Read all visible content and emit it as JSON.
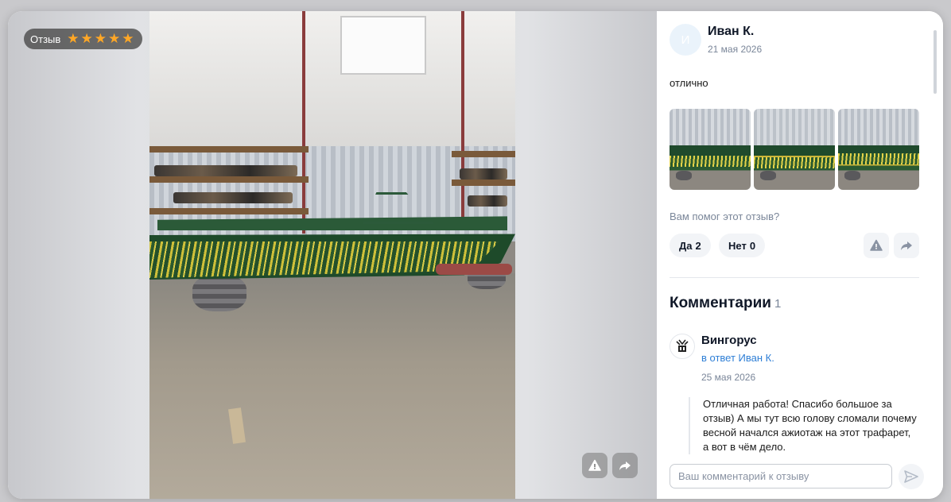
{
  "badge": {
    "label": "Отзыв",
    "rating": 5,
    "max_rating": 5,
    "star_color": "#ffa726"
  },
  "review": {
    "author": "Иван К.",
    "avatar_letter": "И",
    "date": "21 мая 2026",
    "text": "отлично",
    "photos_count": 3
  },
  "helpful": {
    "question": "Вам помог этот отзыв?",
    "yes_label": "Да",
    "yes_count": "2",
    "no_label": "Нет",
    "no_count": "0"
  },
  "comments": {
    "title": "Комментарии",
    "count": "1",
    "items": [
      {
        "author": "Вингорус",
        "reply_to": "в ответ Иван К.",
        "date": "25 мая 2026",
        "text": "Отличная работа! Спасибо большое за отзыв) А мы тут всю голову сломали почему весной начался ажиотаж на этот трафарет, а вот в чём дело."
      }
    ]
  },
  "input": {
    "placeholder": "Ваш комментарий к отзыву",
    "value": ""
  },
  "icons": {
    "report": "warning-icon",
    "share": "share-arrow-icon",
    "send": "send-icon"
  },
  "colors": {
    "link": "#2f7fd6",
    "muted": "#7a8699",
    "title": "#101828"
  }
}
